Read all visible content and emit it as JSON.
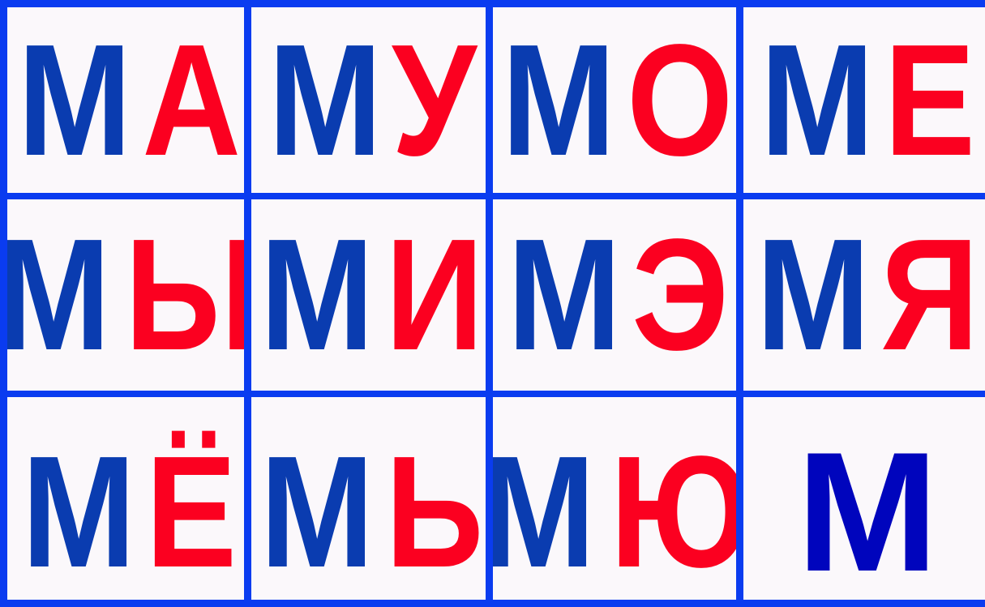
{
  "colors": {
    "background_grid": "#0a3cf0",
    "card": "#fbf8fb",
    "consonant": "#0a3cb0",
    "vowel": "#fb0020",
    "single_consonant": "#0005bd"
  },
  "cards": [
    {
      "consonant": "М",
      "vowel": "А"
    },
    {
      "consonant": "М",
      "vowel": "У"
    },
    {
      "consonant": "М",
      "vowel": "О"
    },
    {
      "consonant": "М",
      "vowel": "Е"
    },
    {
      "consonant": "М",
      "vowel": "Ы"
    },
    {
      "consonant": "М",
      "vowel": "И"
    },
    {
      "consonant": "М",
      "vowel": "Э"
    },
    {
      "consonant": "М",
      "vowel": "Я"
    },
    {
      "consonant": "М",
      "vowel": "Ё"
    },
    {
      "consonant": "М",
      "vowel": "Ь"
    },
    {
      "consonant": "М",
      "vowel": "Ю"
    },
    {
      "consonant": "М",
      "vowel": ""
    }
  ]
}
